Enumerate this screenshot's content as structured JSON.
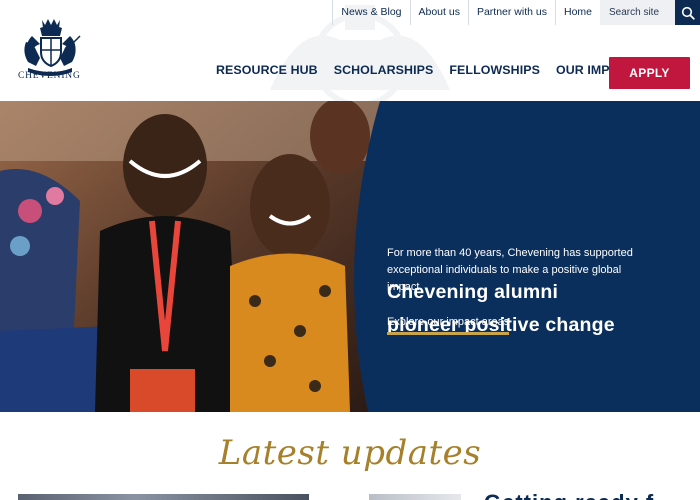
{
  "brand": {
    "name": "CHEVENING",
    "logo_icon": "royal-crest-icon"
  },
  "utility_nav": {
    "items": [
      "News & Blog",
      "About us",
      "Partner with us",
      "Home"
    ],
    "search_placeholder": "Search site",
    "search_icon": "search-icon"
  },
  "main_nav": {
    "items": [
      "RESOURCE HUB",
      "SCHOLARSHIPS",
      "FELLOWSHIPS",
      "OUR IMPACT"
    ],
    "apply_label": "APPLY"
  },
  "hero": {
    "title_line1": "Chevening alumni",
    "title_line2": "pioneer positive change",
    "text": "For more than 40 years, Chevening has supported exceptional individuals to make a positive global impact.",
    "link_label": "Explore our impact areas"
  },
  "latest": {
    "title": "Latest updates",
    "card_heading_partial": "Getting ready f"
  },
  "colors": {
    "navy": "#0d2a52",
    "hero_panel": "#0b2f5c",
    "apply_red": "#c1163d",
    "gold": "#c9a44a",
    "script_gold": "#a6802b"
  }
}
